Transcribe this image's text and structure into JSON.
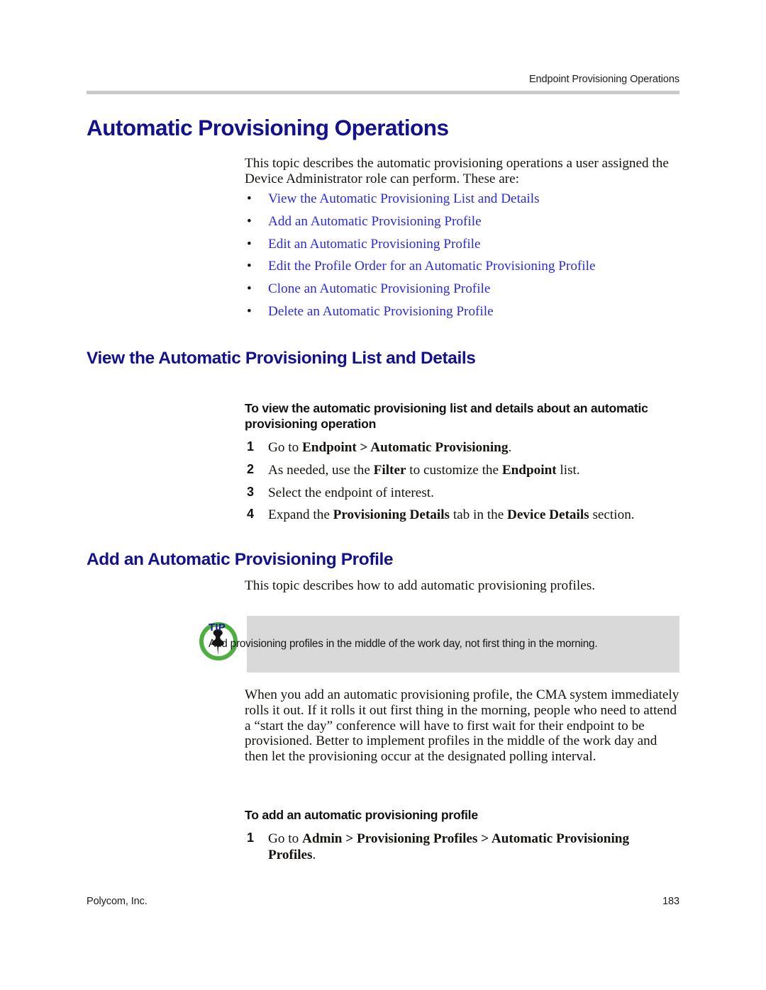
{
  "header": {
    "running_head": "Endpoint Provisioning Operations"
  },
  "chapter": {
    "title": "Automatic Provisioning Operations",
    "intro": "This topic describes the automatic provisioning operations a user assigned the Device Administrator role can perform. These are:",
    "links": [
      {
        "bullet": "•",
        "label": "View the Automatic Provisioning List and Details"
      },
      {
        "bullet": "•",
        "label": "Add an Automatic Provisioning Profile"
      },
      {
        "bullet": "•",
        "label": "Edit an Automatic Provisioning Profile"
      },
      {
        "bullet": "•",
        "label": "Edit the Profile Order for an Automatic Provisioning Profile"
      },
      {
        "bullet": "•",
        "label": "Clone an Automatic Provisioning Profile"
      },
      {
        "bullet": "•",
        "label": "Delete an Automatic Provisioning Profile"
      }
    ]
  },
  "section_view": {
    "heading": "View the Automatic Provisioning List and Details",
    "procedure_heading": "To view the automatic provisioning list and details about an automatic provisioning operation",
    "steps": [
      {
        "num": "1",
        "html": "Go to <b>Endpoint &gt; Automatic Provisioning</b>."
      },
      {
        "num": "2",
        "html": "As needed, use the <b>Filter</b> to customize the <b>Endpoint</b> list."
      },
      {
        "num": "3",
        "html": "Select the endpoint of interest."
      },
      {
        "num": "4",
        "html": "Expand the <b>Provisioning Details</b> tab in the <b>Device Details</b> section."
      }
    ]
  },
  "section_add": {
    "heading": "Add an Automatic Provisioning Profile",
    "intro": "This topic describes how to add automatic provisioning profiles.",
    "tip": {
      "label": "TIP",
      "text": "Add provisioning profiles in the middle of the work day, not first thing in the morning.",
      "icon": "pushpin-icon",
      "icon_ring_color": "#4caf3f",
      "icon_pin_color": "#141414",
      "box_color": "#d9d9d9"
    },
    "body": "When you add an automatic provisioning profile, the CMA system immediately rolls it out. If it rolls it out first thing in the morning, people who need to attend a “start the day” conference will have to first wait for their endpoint to be provisioned. Better to implement profiles in the middle of the work day and then let the provisioning occur at the designated polling interval.",
    "procedure_heading": "To add an automatic provisioning profile",
    "steps": [
      {
        "num": "1",
        "html": "Go to <b>Admin &gt; Provisioning Profiles &gt; Automatic Provisioning Profiles</b>."
      }
    ]
  },
  "footer": {
    "company": "Polycom, Inc.",
    "page_number": "183"
  },
  "colors": {
    "heading_blue": "#14118c",
    "link_blue": "#2b2bd8",
    "rule_gray": "#c9c9c9",
    "text_black": "#16130f"
  }
}
